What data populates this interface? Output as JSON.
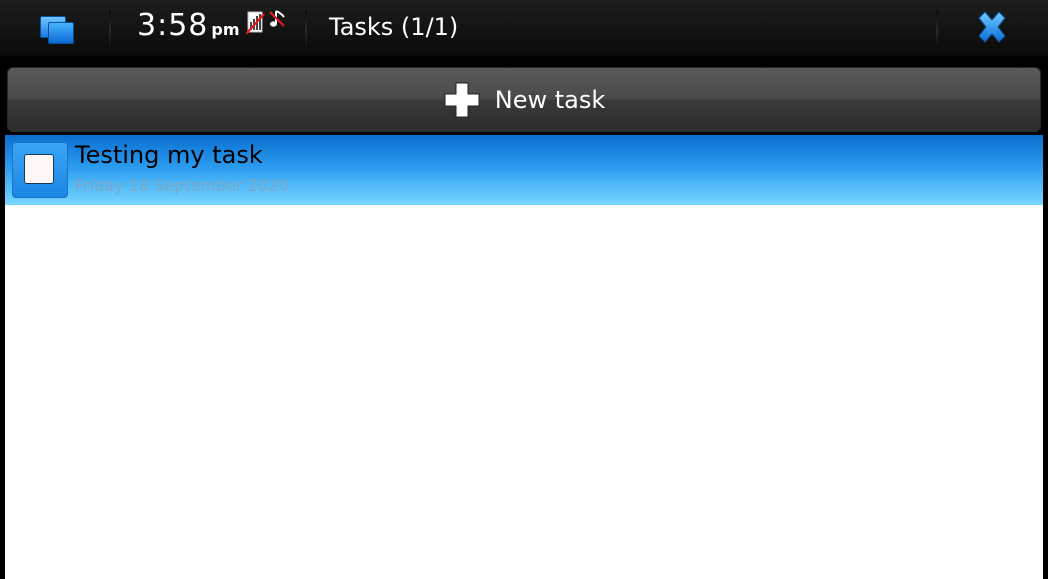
{
  "statusbar": {
    "time": "3:58",
    "ampm": "pm",
    "title": "Tasks (1/1)",
    "icons": [
      "task-switcher-icon",
      "sim-signal-off-icon",
      "music-off-icon",
      "close-icon"
    ]
  },
  "new_task": {
    "label": "New task",
    "icon": "plus-icon"
  },
  "tasks": [
    {
      "title": "Testing my task",
      "date": "Friday 18 September 2020",
      "completed": false,
      "selected": true
    }
  ],
  "colors": {
    "accent": "#2a9aee",
    "close": "#1e90ff",
    "background": "#ffffff",
    "bar": "#0a0a0a"
  }
}
